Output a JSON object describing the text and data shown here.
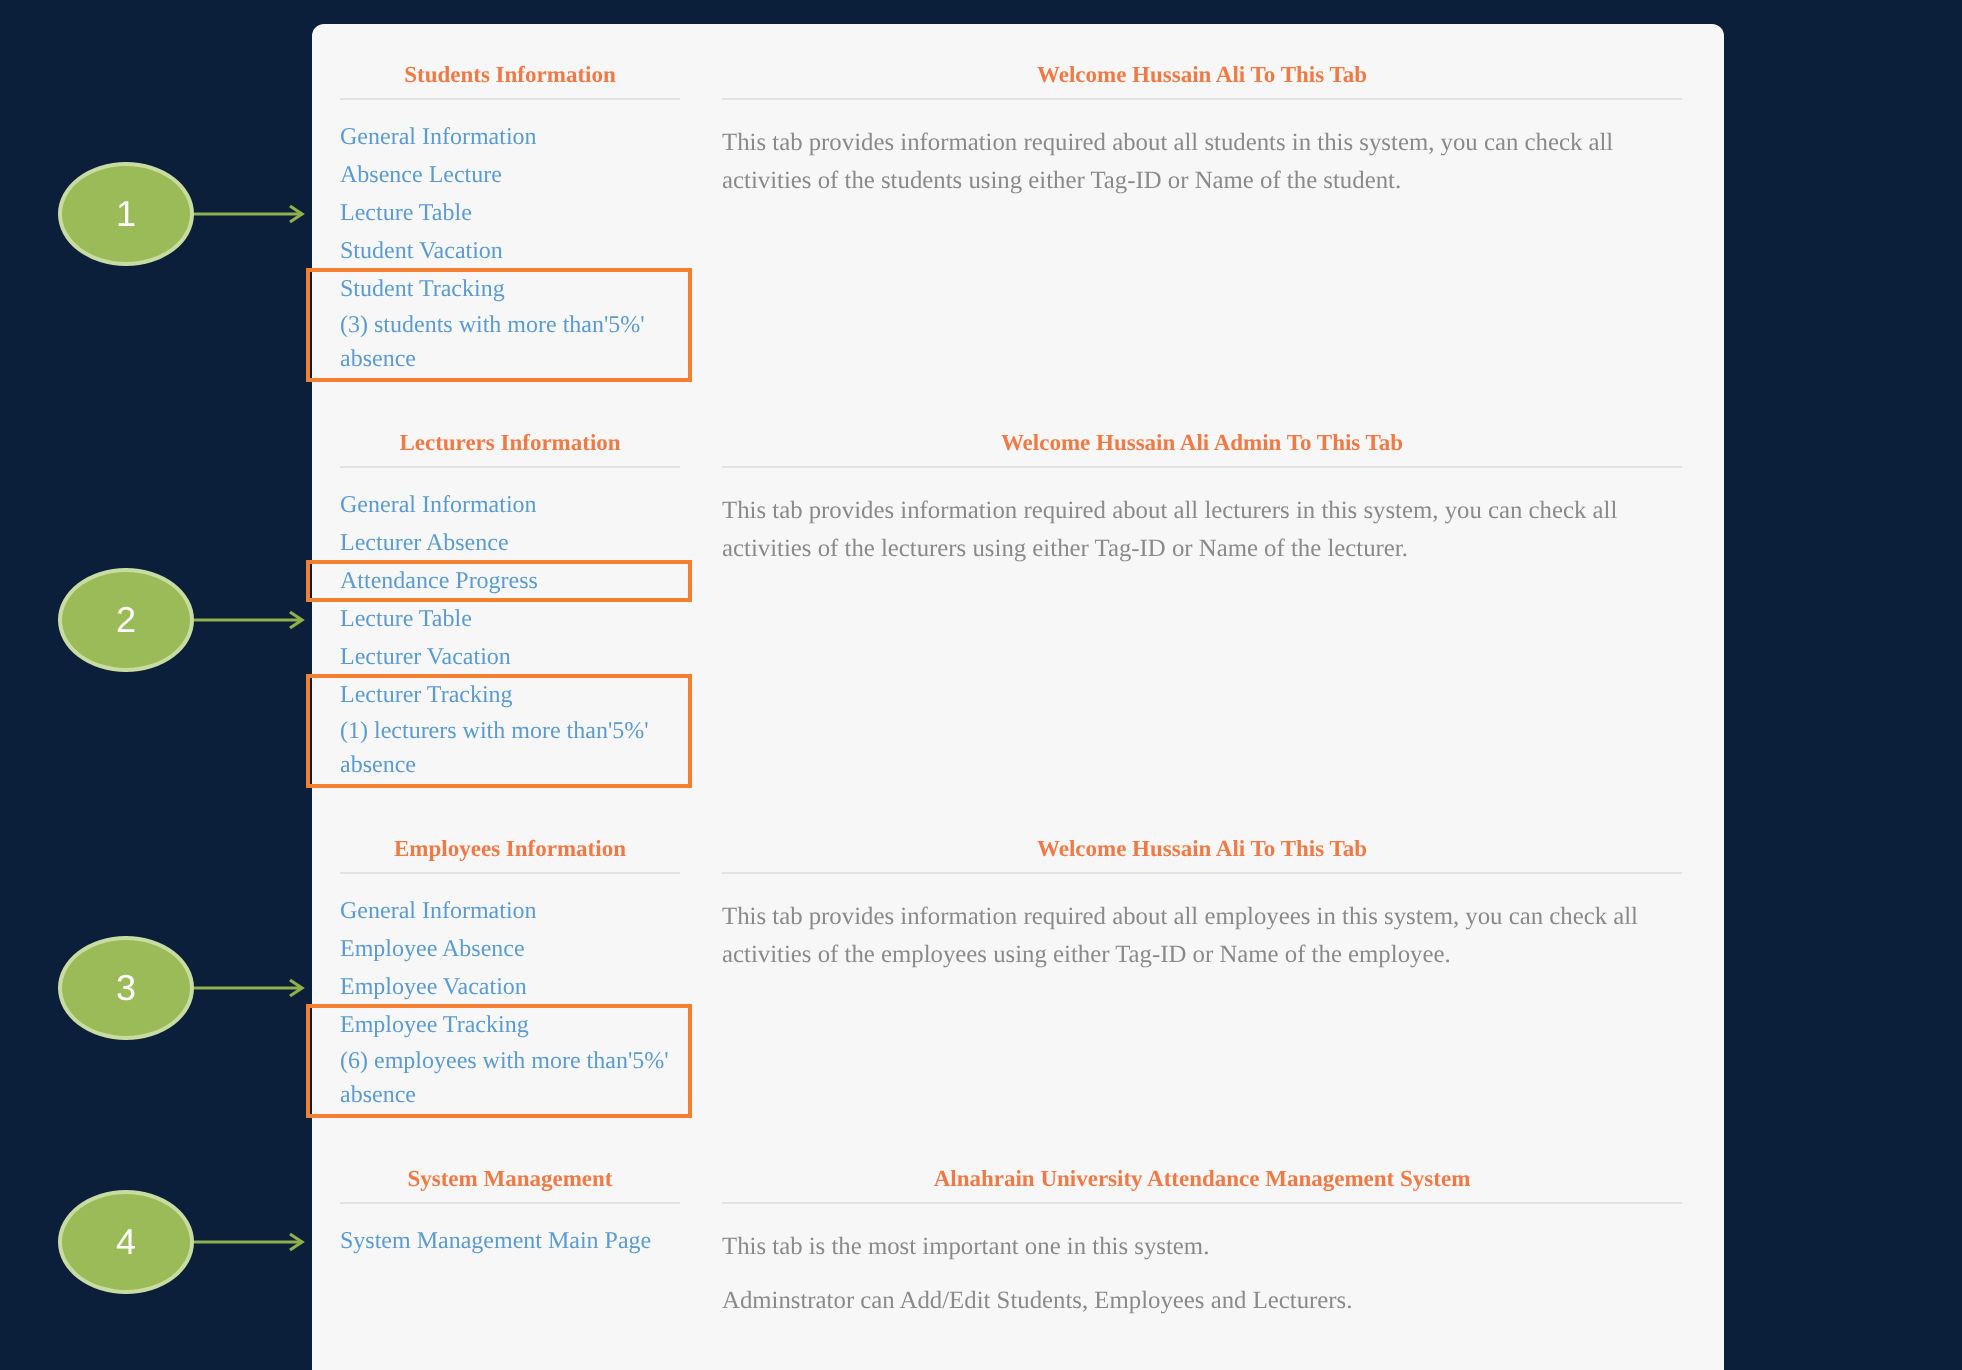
{
  "sections": [
    {
      "heading": "Students Information",
      "title": "Welcome Hussain Ali To This Tab",
      "links": [
        {
          "text": "General Information",
          "highlighted": false
        },
        {
          "text": "Absence Lecture",
          "highlighted": false
        },
        {
          "text": "Lecture Table",
          "highlighted": false,
          "callout": "1"
        },
        {
          "text": "Student Vacation",
          "highlighted": false
        },
        {
          "text": "Student Tracking",
          "detail": "(3) students with more than'5%' absence",
          "highlighted": true
        }
      ],
      "paragraphs": [
        "This tab provides information required about all students in this system, you can check all activities of the students using either Tag-ID or Name of the student."
      ]
    },
    {
      "heading": "Lecturers Information",
      "title": "Welcome Hussain Ali Admin To This Tab",
      "links": [
        {
          "text": "General Information",
          "highlighted": false
        },
        {
          "text": "Lecturer Absence",
          "highlighted": false
        },
        {
          "text": "Attendance Progress",
          "highlighted": true
        },
        {
          "text": "Lecture Table",
          "highlighted": false,
          "callout": "2"
        },
        {
          "text": "Lecturer Vacation",
          "highlighted": false
        },
        {
          "text": "Lecturer Tracking",
          "detail": "(1) lecturers with more than'5%' absence",
          "highlighted": true
        }
      ],
      "paragraphs": [
        "This tab provides information required about all lecturers in this system, you can check all activities of the lecturers using either Tag-ID or Name of the lecturer."
      ]
    },
    {
      "heading": "Employees Information",
      "title": "Welcome Hussain Ali To This Tab",
      "links": [
        {
          "text": "General Information",
          "highlighted": false
        },
        {
          "text": "Employee Absence",
          "highlighted": false
        },
        {
          "text": "Employee Vacation",
          "highlighted": false,
          "callout": "3"
        },
        {
          "text": "Employee Tracking",
          "detail": "(6) employees with more than'5%' absence",
          "highlighted": true
        }
      ],
      "paragraphs": [
        "This tab provides information required about all employees in this system, you can check all activities of the employees using either Tag-ID or Name of the employee."
      ]
    },
    {
      "heading": "System Management",
      "title": "Alnahrain University Attendance Management System",
      "links": [
        {
          "text": "System Management Main Page",
          "highlighted": false,
          "callout": "4"
        }
      ],
      "paragraphs": [
        "This tab is the most important one in this system.",
        "Adminstrator can Add/Edit Students, Employees and Lecturers."
      ]
    }
  ]
}
